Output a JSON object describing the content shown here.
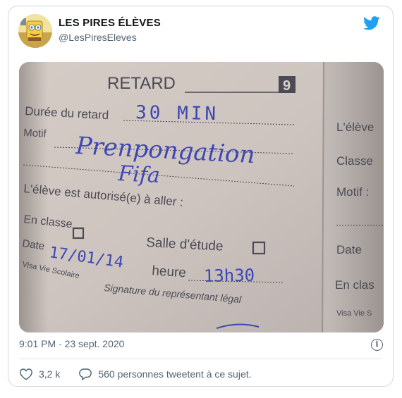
{
  "tweet": {
    "author_name": "LES PIRES ÉLÈVES",
    "author_handle": "@LesPiresEleves",
    "timestamp": "9:01 PM · 23 sept. 2020",
    "likes": "3,2 k",
    "retweet_text": "560 personnes tweetent à ce sujet.",
    "brand_color": "#1da1f2"
  },
  "photo": {
    "title": "RETARD",
    "number": "9",
    "duration_label": "Durée du retard",
    "duration_value": "30 MIN",
    "motif_label": "Motif",
    "motif_line1": "Prenpongation",
    "motif_line2": "Fifa",
    "authorized_label": "L'élève est autorisé(e) à aller :",
    "en_classe_label": "En classe",
    "salle_label": "Salle d'étude",
    "date_label": "Date",
    "date_value": "17/01/14",
    "heure_label": "heure",
    "heure_value": "13h30",
    "visa_label": "Visa Vie Scolaire",
    "signature_label": "Signature du représentant légal",
    "side_eleve": "L'élève",
    "side_classe": "Classe",
    "side_motif": "Motif :",
    "side_date": "Date",
    "side_en_classe": "En clas",
    "side_visa": "Visa Vie S"
  }
}
